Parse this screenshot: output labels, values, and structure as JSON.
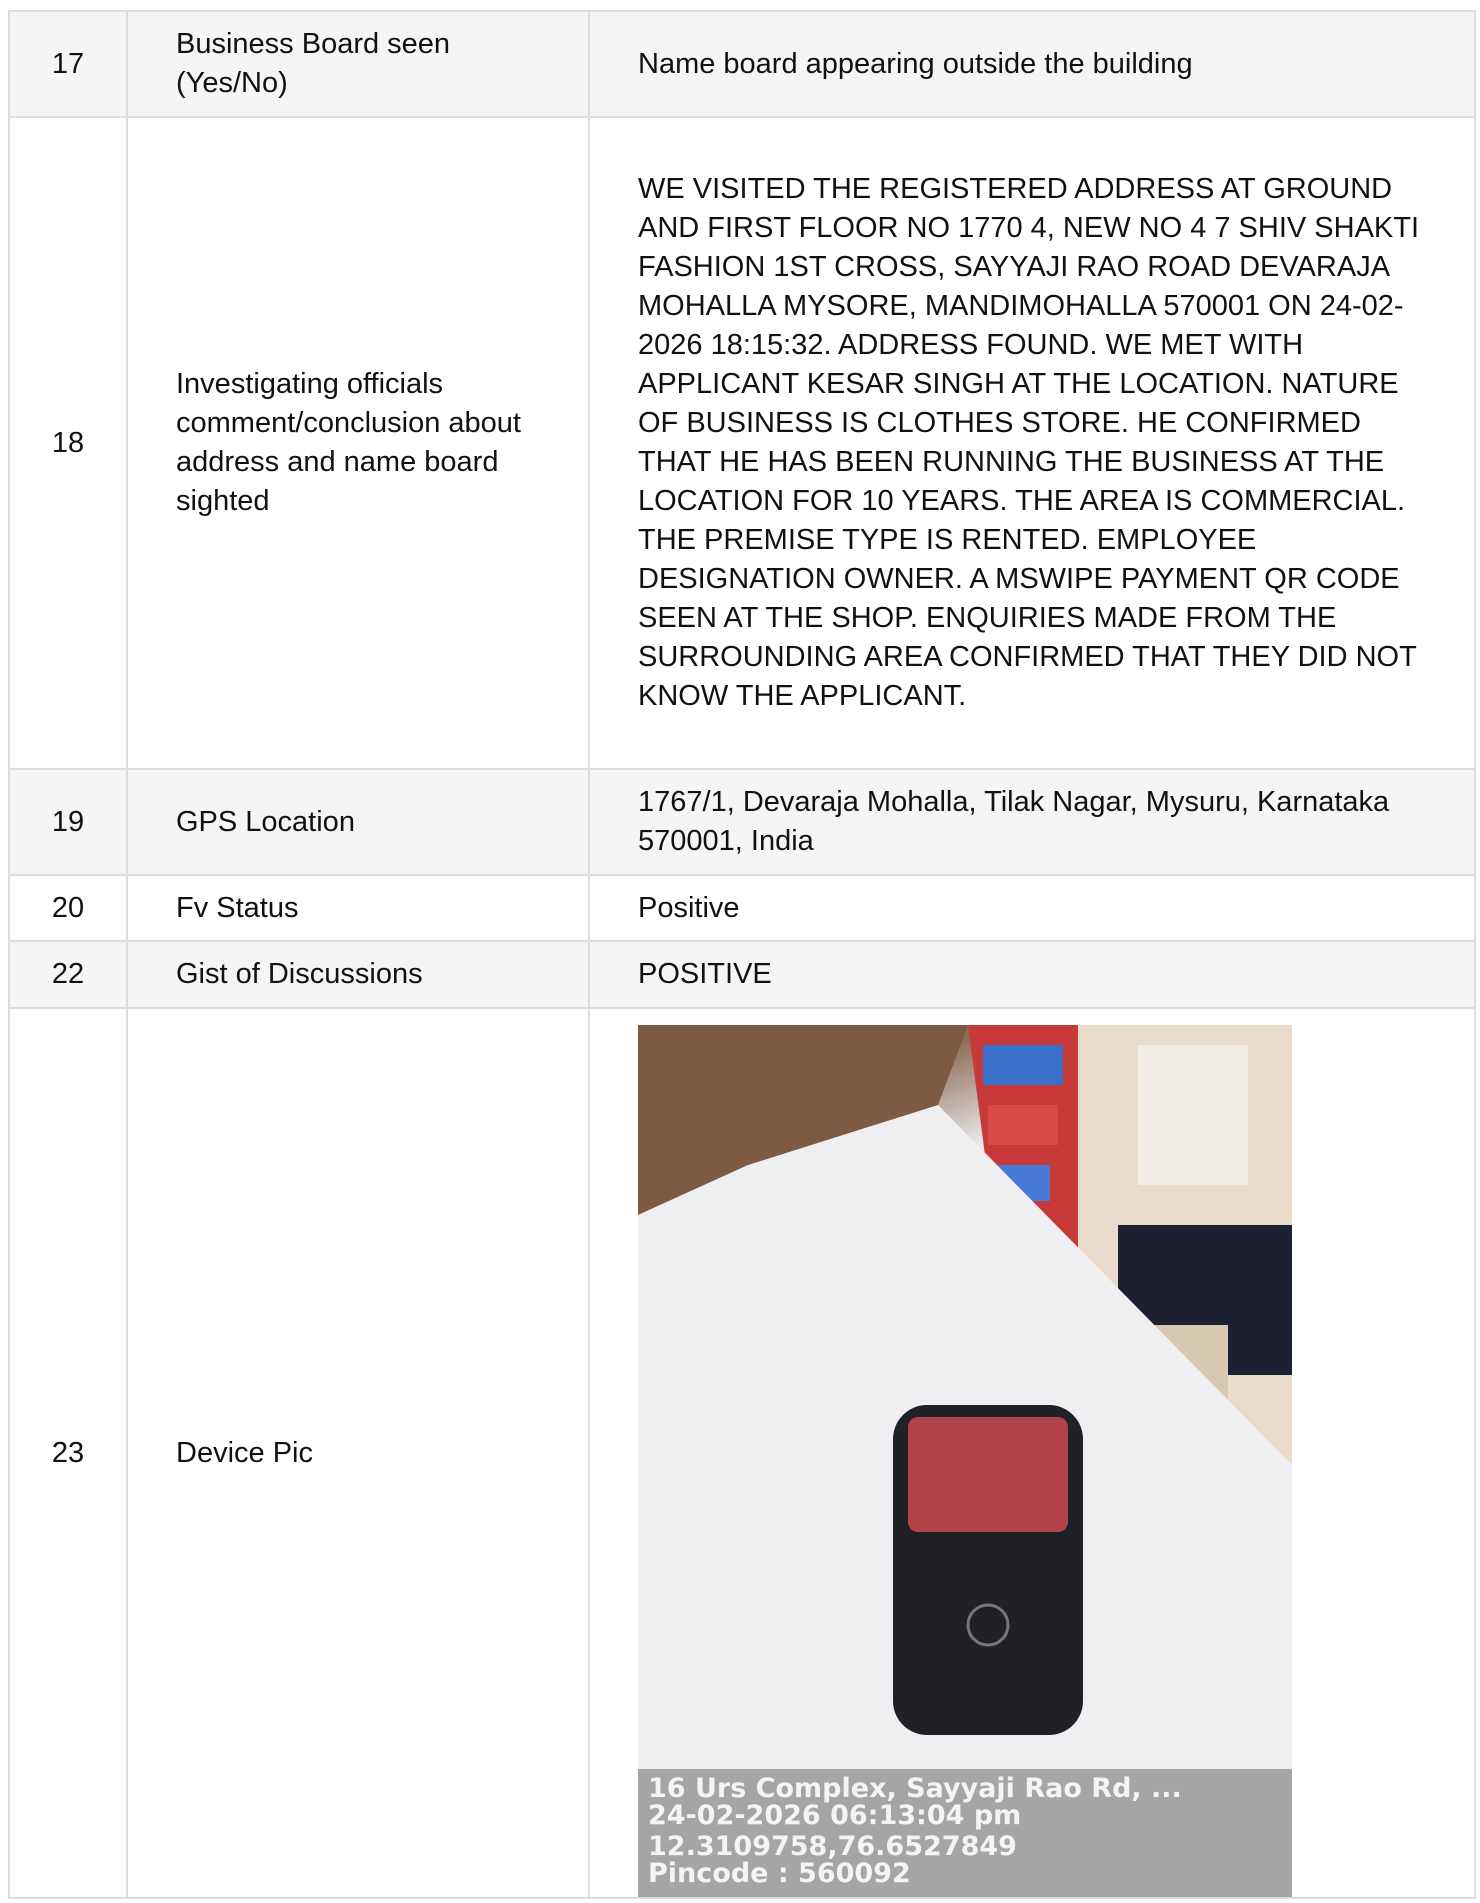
{
  "rows": [
    {
      "num": "17",
      "label": "Business Board seen (Yes/No)",
      "value": "Name board appearing outside the building"
    },
    {
      "num": "18",
      "label": "Investigating officials comment/conclusion about address and name board sighted",
      "value": "WE VISITED THE REGISTERED ADDRESS AT GROUND AND FIRST FLOOR NO 1770 4, NEW NO 4 7 SHIV SHAKTI FASHION 1ST CROSS, SAYYAJI RAO ROAD DEVARAJA MOHALLA MYSORE, MANDIMOHALLA 570001 ON 24-02-2026 18:15:32. ADDRESS FOUND. WE MET WITH APPLICANT KESAR SINGH AT THE LOCATION. NATURE OF BUSINESS IS CLOTHES STORE. HE CONFIRMED THAT HE HAS BEEN RUNNING THE BUSINESS AT THE LOCATION FOR 10 YEARS. THE AREA IS COMMERCIAL. THE PREMISE TYPE IS RENTED. EMPLOYEE DESIGNATION OWNER. A MSWIPE PAYMENT QR CODE SEEN AT THE SHOP. ENQUIRIES MADE FROM THE SURROUNDING AREA CONFIRMED THAT THEY DID NOT KNOW THE APPLICANT."
    },
    {
      "num": "19",
      "label": "GPS Location",
      "value": "1767/1, Devaraja Mohalla, Tilak Nagar, Mysuru, Karnataka 570001, India"
    },
    {
      "num": "20",
      "label": "Fv Status",
      "value": "Positive"
    },
    {
      "num": "22",
      "label": "Gist of Discussions",
      "value": "POSITIVE"
    },
    {
      "num": "23",
      "label": "Device Pic",
      "photo_overlay": {
        "line1": "16 Urs Complex, Sayyaji Rao Rd, ...",
        "line2": "24-02-2026 06:13:04 pm",
        "line3": "12.3109758,76.6527849",
        "line4": "Pincode : 560092"
      }
    }
  ]
}
